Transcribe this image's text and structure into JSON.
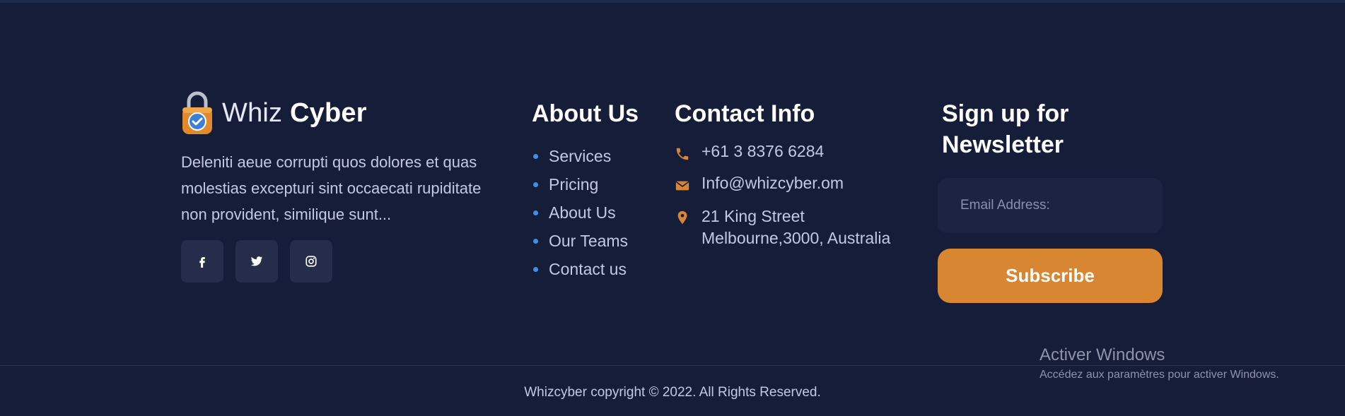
{
  "brand": {
    "name_light": "Whiz",
    "name_bold": "Cyber",
    "description": "Deleniti aeue corrupti quos dolores et quas molestias excepturi sint occaecati rupiditate non provident, similique sunt...",
    "socials": [
      {
        "icon": "facebook-icon"
      },
      {
        "icon": "twitter-icon"
      },
      {
        "icon": "instagram-icon"
      }
    ]
  },
  "about": {
    "title": "About Us",
    "links": [
      "Services",
      "Pricing",
      "About Us",
      "Our Teams",
      "Contact us"
    ]
  },
  "contact": {
    "title": "Contact Info",
    "phone": "+61 3 8376 6284",
    "email": "Info@whizcyber.om",
    "address_line1": "21 King Street",
    "address_line2": "Melbourne,3000, Australia"
  },
  "newsletter": {
    "title": "Sign up for Newsletter",
    "email_placeholder": "Email Address:",
    "subscribe_label": "Subscribe"
  },
  "footer": {
    "copyright": "Whizcyber copyright © 2022. All Rights Reserved."
  },
  "watermark": {
    "title": "Activer Windows",
    "subtitle": "Accédez aux paramètres pour activer Windows."
  },
  "colors": {
    "background": "#161d38",
    "accent_orange": "#d88632",
    "bullet_blue": "#3f8fe8",
    "social_tile": "#252d4a"
  }
}
